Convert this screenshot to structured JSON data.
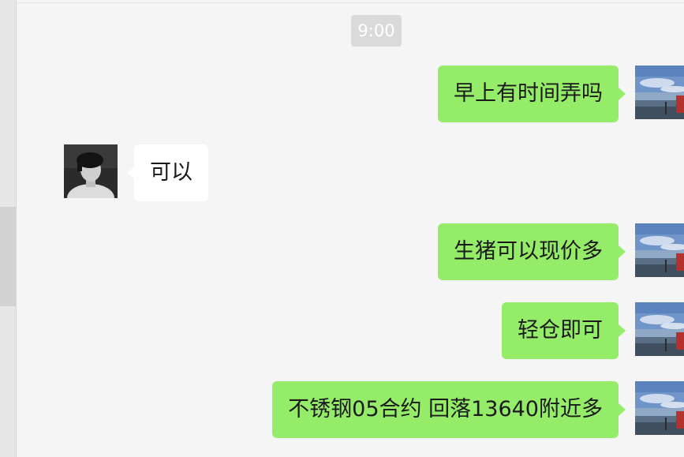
{
  "timestamp": "9:00",
  "messages": [
    {
      "id": "m1",
      "direction": "sent",
      "text": "早上有时间弄吗"
    },
    {
      "id": "m2",
      "direction": "received",
      "text": "可以"
    },
    {
      "id": "m3",
      "direction": "sent",
      "text": "生猪可以现价多"
    },
    {
      "id": "m4",
      "direction": "sent",
      "text": "轻仓即可"
    },
    {
      "id": "m5",
      "direction": "sent",
      "text": "不锈钢05合约 回落13640附近多"
    }
  ],
  "colors": {
    "background": "#f5f5f5",
    "sent_bubble": "#95ec69",
    "received_bubble": "#ffffff",
    "time_badge": "#dadada"
  }
}
